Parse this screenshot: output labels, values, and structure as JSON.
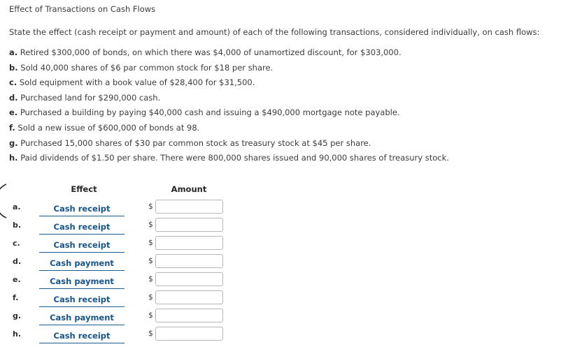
{
  "page": {
    "title": "Effect of Transactions on Cash Flows",
    "prompt": "State the effect (cash receipt or payment and amount) of each of the following transactions, considered individually, on cash flows:"
  },
  "transactions": [
    {
      "letter": "a.",
      "text": "Retired $300,000 of bonds, on which there was $4,000 of unamortized discount, for $303,000."
    },
    {
      "letter": "b.",
      "text": "Sold 40,000 shares of $6 par common stock for $18 per share."
    },
    {
      "letter": "c.",
      "text": "Sold equipment with a book value of $28,400 for $31,500."
    },
    {
      "letter": "d.",
      "text": "Purchased land for $290,000 cash."
    },
    {
      "letter": "e.",
      "text": "Purchased a building by paying $40,000 cash and issuing a $490,000 mortgage note payable."
    },
    {
      "letter": "f.",
      "text": "Sold a new issue of $600,000 of bonds at 98."
    },
    {
      "letter": "g.",
      "text": "Purchased 15,000 shares of $30 par common stock as treasury stock at $45 per share."
    },
    {
      "letter": "h.",
      "text": "Paid dividends of $1.50 per share. There were 800,000 shares issued and 90,000 shares of treasury stock."
    }
  ],
  "answer_table": {
    "columns": {
      "effect": "Effect",
      "amount": "Amount"
    },
    "currency_symbol": "$",
    "rows": [
      {
        "letter": "a.",
        "effect": "Cash receipt",
        "amount": ""
      },
      {
        "letter": "b.",
        "effect": "Cash receipt",
        "amount": ""
      },
      {
        "letter": "c.",
        "effect": "Cash receipt",
        "amount": ""
      },
      {
        "letter": "d.",
        "effect": "Cash payment",
        "amount": ""
      },
      {
        "letter": "e.",
        "effect": "Cash payment",
        "amount": ""
      },
      {
        "letter": "f.",
        "effect": "Cash receipt",
        "amount": ""
      },
      {
        "letter": "g.",
        "effect": "Cash payment",
        "amount": ""
      },
      {
        "letter": "h.",
        "effect": "Cash receipt",
        "amount": ""
      }
    ]
  },
  "colors": {
    "effect_link": "#18558c",
    "body_text": "#3c3c3c",
    "input_border": "#b6b6b6"
  }
}
